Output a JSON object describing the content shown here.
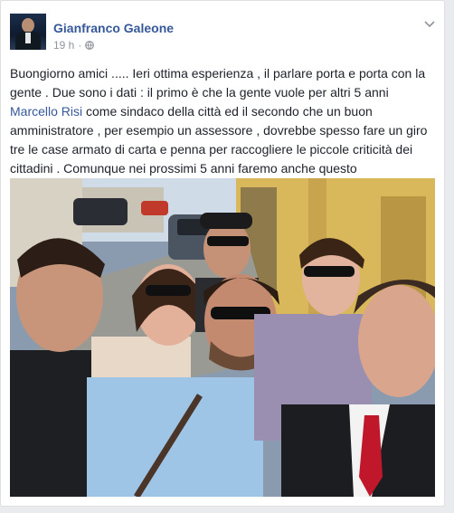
{
  "post": {
    "author": "Gianfranco Galeone",
    "time": "19 h",
    "separator": "·",
    "privacy_icon": "globe-icon",
    "options_icon": "chevron-down-icon",
    "text_part1": "Buongiorno amici ..... Ieri ottima esperienza , il parlare porta e porta con la gente . Due sono i dati : il primo è che la gente vuole per altri 5 anni ",
    "mention": "Marcello Risi",
    "text_part2": " come sindaco della città ed il secondo che un buon amministratore , per esempio un assessore , dovrebbe spesso fare un giro tre le case armato di carta e penna per raccogliere le piccole criticità dei cittadini . Comunque nei prossimi 5 anni faremo anche questo",
    "photo_subject": "group-selfie-photo"
  },
  "colors": {
    "link": "#365899",
    "text": "#1d2129",
    "meta": "#90949c",
    "background": "#e9ebee"
  }
}
